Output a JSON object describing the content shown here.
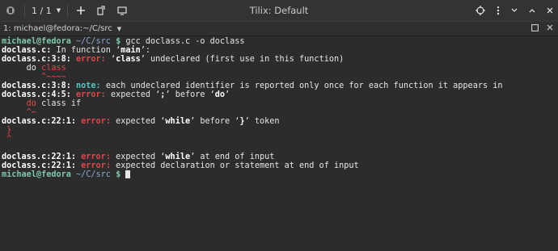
{
  "titlebar": {
    "session_counter": "1 / 1",
    "title": "Tilix: Default",
    "icons": [
      "tilix-icon",
      "add-icon",
      "detach-icon",
      "notification-icon",
      "search-icon",
      "menu-icon",
      "minimize-icon",
      "maximize-icon",
      "close-icon"
    ]
  },
  "tab": {
    "title": "1: michael@fedora:~/C/src",
    "caret": "▼"
  },
  "prompt": {
    "user": "michael@fedora",
    "path": "~/C/src",
    "symbol": "$"
  },
  "lines": [
    {
      "type": "prompt",
      "cmd": "gcc doclass.c -o doclass"
    },
    {
      "file": "doclass.c:",
      "text": " In function ‘",
      "bold": "main",
      "end": "’:"
    },
    {
      "file": "doclass.c:3:8:",
      "kind": "error",
      "msg": " ‘",
      "bold": "class",
      "end": "’ undeclared (first use in this function)"
    },
    {
      "code": "     do ",
      "codeRed": "class"
    },
    {
      "caret": "        ^~~~~"
    },
    {
      "file": "doclass.c:3:8:",
      "kind": "note",
      "msg": " each undeclared identifier is reported only once for each function it appears in"
    },
    {
      "file": "doclass.c:4:5:",
      "kind": "error",
      "msg": " expected ‘",
      "bold": ";",
      "end": "’ before ‘",
      "bold2": "do",
      "end2": "’"
    },
    {
      "code": "     ",
      "codeRed": "do",
      "codeTail": " class if"
    },
    {
      "caret": "     ^~"
    },
    {
      "file": "doclass.c:22:1:",
      "kind": "error",
      "msg": " expected ‘",
      "bold": "while",
      "end": "’ before ‘",
      "bold2": "}",
      "end2": "’ token"
    },
    {
      "codeRed": " }"
    },
    {
      "caret": " ^"
    },
    {
      "blank": true
    },
    {
      "file": "doclass.c:22:1:",
      "kind": "error",
      "msg": " expected ‘",
      "bold": "while",
      "end": "’ at end of input"
    },
    {
      "file": "doclass.c:22:1:",
      "kind": "error",
      "msg": " expected declaration or statement at end of input"
    },
    {
      "type": "prompt",
      "cmd": ""
    }
  ],
  "colors": {
    "background": "#2c2c2c",
    "error": "#e0474b",
    "note": "#58c4c4",
    "prompt_user": "#7fc8a9",
    "prompt_path": "#8aa8d0"
  }
}
